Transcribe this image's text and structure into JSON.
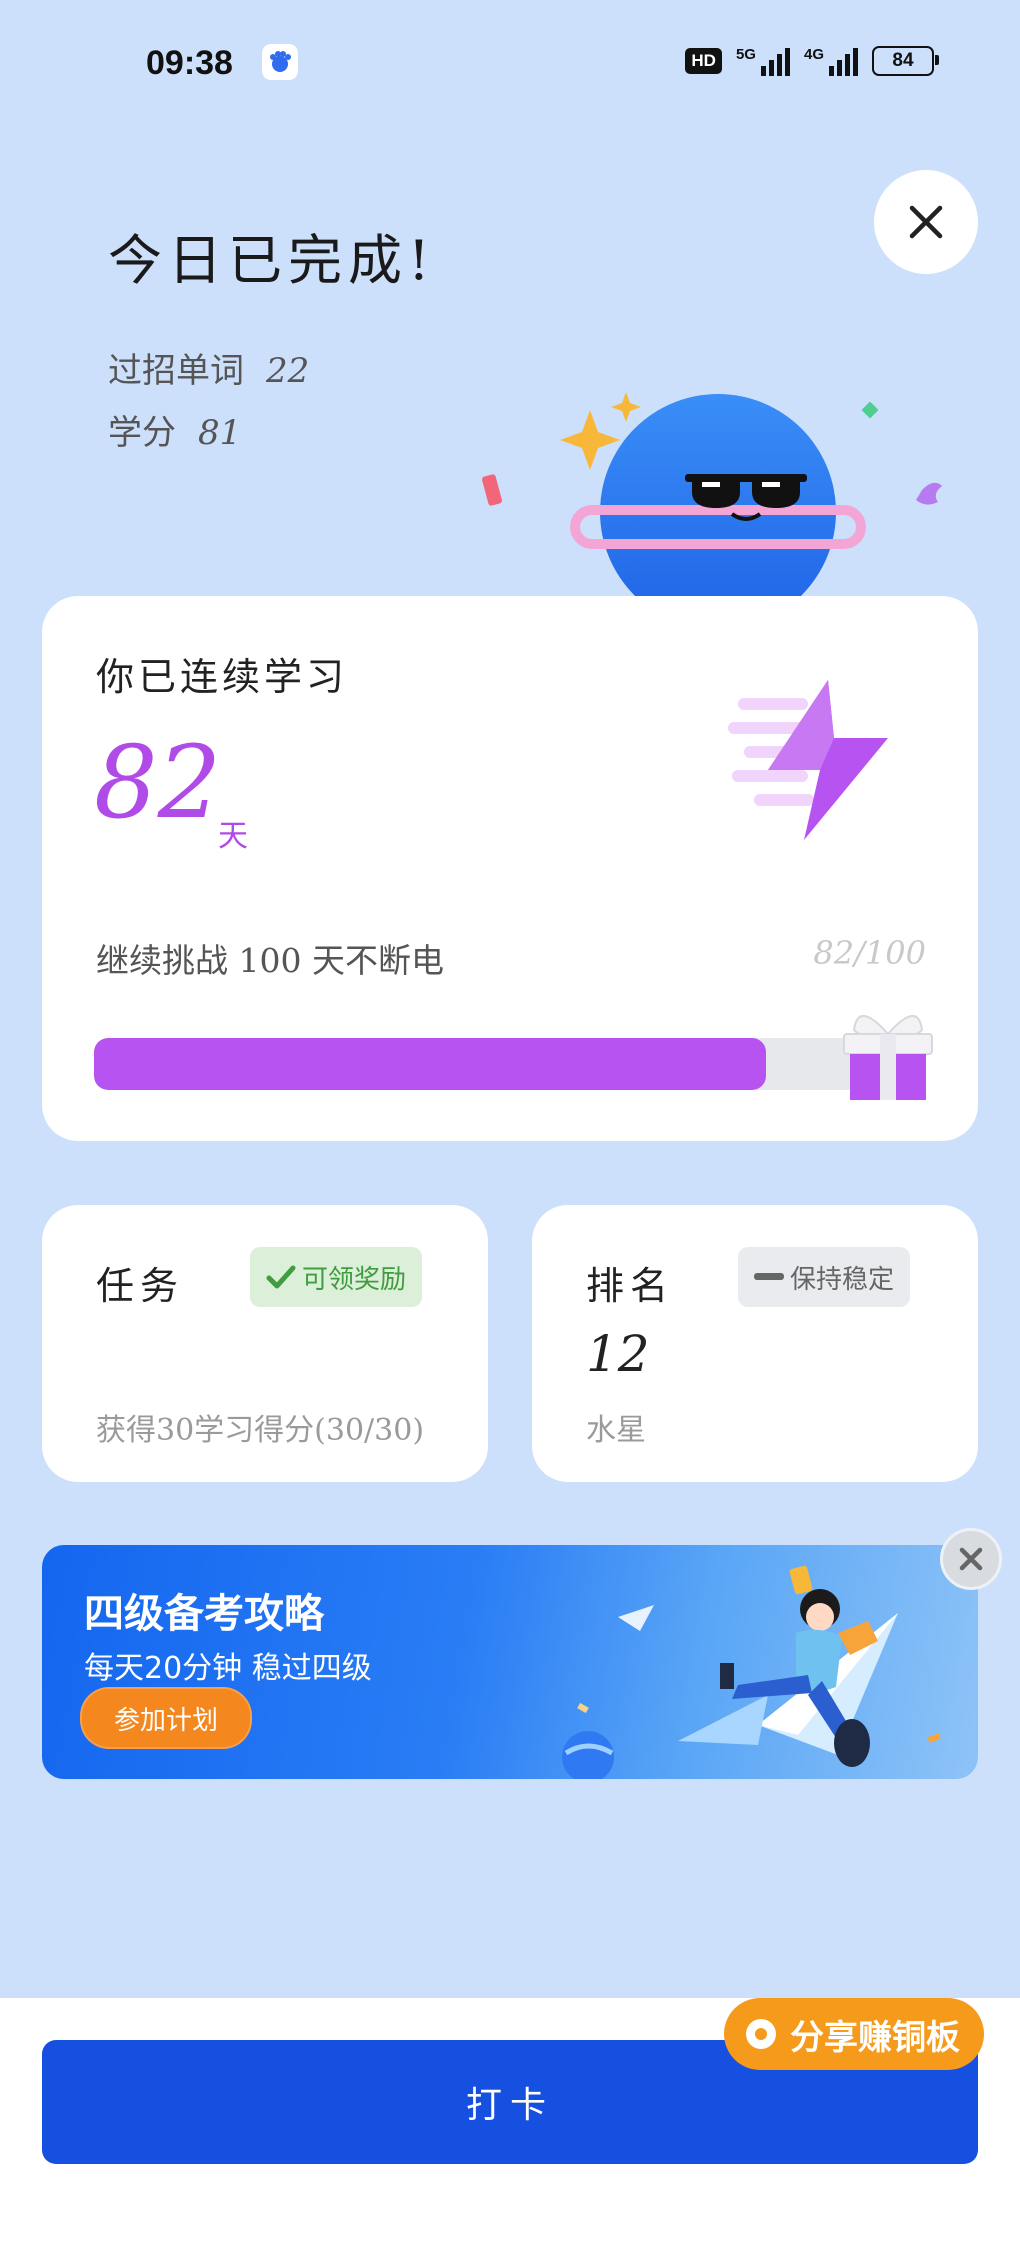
{
  "status_bar": {
    "time": "09:38",
    "hd": "HD",
    "net1": "5G",
    "net2": "4G",
    "battery": "84"
  },
  "header": {
    "title": "今日已完成!",
    "words_label": "过招单词",
    "words_value": "22",
    "credits_label": "学分",
    "credits_value": "81"
  },
  "streak": {
    "label": "你已连续学习",
    "days": "82",
    "unit": "天",
    "challenge": "继续挑战 100 天不断电",
    "progress_text": "82/100",
    "progress_fraction": 0.82,
    "color": "#b04be8"
  },
  "task_card": {
    "title": "任务",
    "badge": "可领奖励",
    "subtitle": "获得30学习得分(30/30)"
  },
  "rank_card": {
    "title": "排名",
    "badge": "保持稳定",
    "rank": "12",
    "subtitle": "水星"
  },
  "banner": {
    "title": "四级备考攻略",
    "subtitle": "每天20分钟 稳过四级",
    "button": "参加计划"
  },
  "footer": {
    "checkin": "打卡",
    "share": "分享赚铜板"
  },
  "colors": {
    "background": "#cde0fb",
    "primary": "#1550e0",
    "accent": "#b753f0",
    "orange": "#f59a1b"
  }
}
